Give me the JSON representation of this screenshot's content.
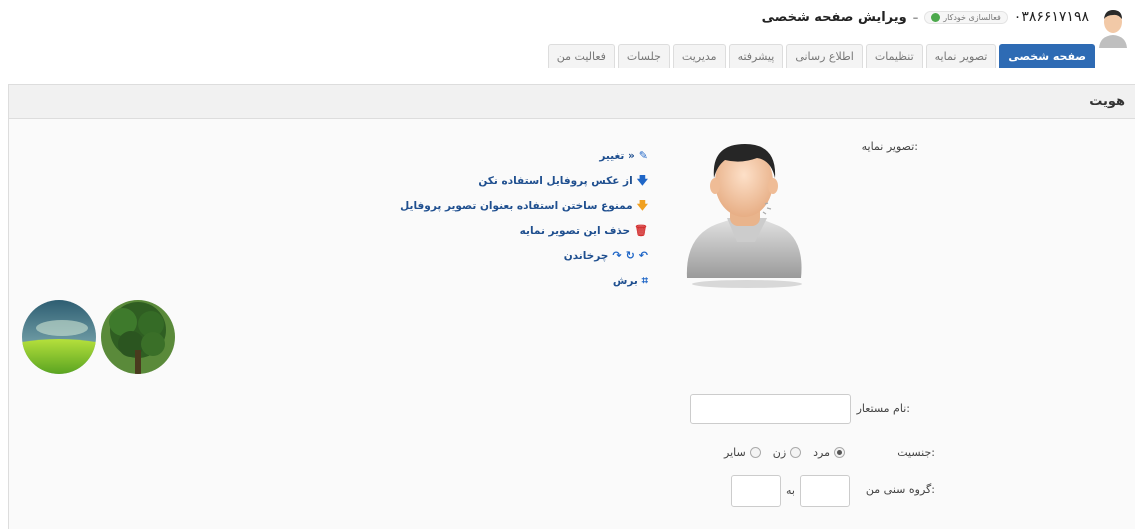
{
  "header": {
    "phone": "۰۳۸۶۶۱۷۱۹۸",
    "status_badge": "فعالسازی خودکار",
    "separator": "–",
    "title": "ویرایش صفحه شخصی"
  },
  "tabs": [
    {
      "label": "صفحه شخصی",
      "active": true
    },
    {
      "label": "تصویر نمایه"
    },
    {
      "label": "تنظیمات"
    },
    {
      "label": "اطلاع رسانی"
    },
    {
      "label": "پیشرفته"
    },
    {
      "label": "مدیریت"
    },
    {
      "label": "جلسات"
    },
    {
      "label": "فعالیت من"
    }
  ],
  "panel": {
    "title": "هویت"
  },
  "avatar_section": {
    "label": "تصویر نمایه:",
    "actions": {
      "change": "تغییر »",
      "no_profile_photo": "از عکس پروفایل استفاده نکن",
      "forbid_profile_photo": "ممنوع ساختن استفاده بعنوان تصویر پروفایل",
      "delete": "حذف این تصویر نمایه",
      "rotate": "چرخاندن",
      "crop": "برش"
    }
  },
  "form": {
    "nickname_label": "نام مستعار:",
    "nickname_value": "",
    "gender_label": "جنسیت:",
    "gender_options": {
      "male": "مرد",
      "female": "زن",
      "other": "سایر"
    },
    "gender_selected": "مرد",
    "age_label": "گروه سنی من:",
    "age_to": "به",
    "age_from_value": "",
    "age_to_value": ""
  },
  "colors": {
    "accent": "#2e6bb4",
    "link": "#1f4f8f",
    "status_green": "#4ca94c"
  }
}
